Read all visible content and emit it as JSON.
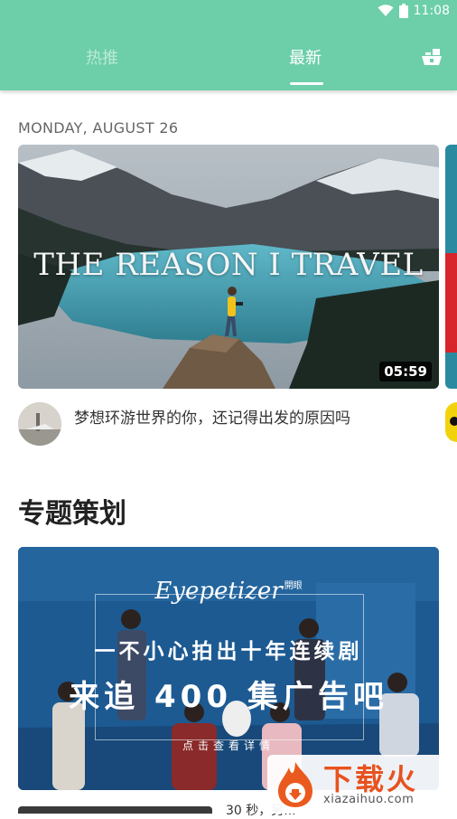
{
  "status_bar": {
    "time": "11:08",
    "icons": [
      "wifi-icon",
      "battery-icon"
    ]
  },
  "header": {
    "tabs": [
      {
        "label": "热推",
        "active": false
      },
      {
        "label": "最新",
        "active": true
      }
    ],
    "right_icon": "ship-icon",
    "background_color": "#6ccfa9"
  },
  "feed": {
    "date_label": "MONDAY, AUGUST 26",
    "video": {
      "overlay_title": "THE REASON I TRAVEL",
      "duration": "05:59",
      "description": "梦想环游世界的你，还记得出发的原因吗"
    }
  },
  "section": {
    "title": "专题策划",
    "promo": {
      "logo": "Eyepetizer",
      "logo_sub": "開眼",
      "line1": "一不小心拍出十年连续剧",
      "line2": "来追 400 集广告吧",
      "cta": "点击查看详情"
    }
  },
  "bottom_peek_text": "30 秒，另...",
  "watermark": {
    "brand": "下载火",
    "url": "xiazaihuo.com"
  }
}
